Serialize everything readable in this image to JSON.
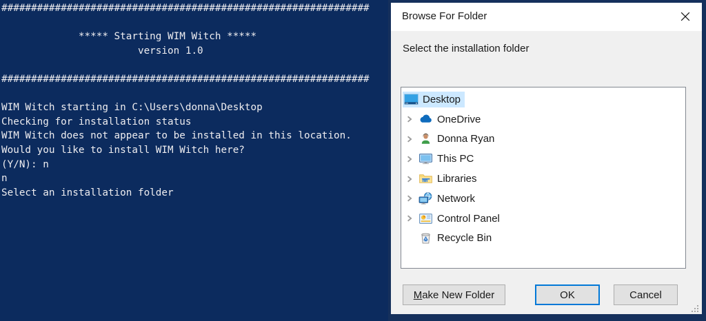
{
  "console": {
    "window_name": "powershell-console",
    "lines": [
      "##############################################################",
      "",
      "             ***** Starting WIM Witch *****",
      "                       version 1.0",
      "",
      "##############################################################",
      "",
      "WIM Witch starting in C:\\Users\\donna\\Desktop",
      "Checking for installation status",
      "WIM Witch does not appear to be installed in this location.",
      "Would you like to install WIM Witch here?",
      "(Y/N): n",
      "n",
      "Select an installation folder"
    ],
    "colors": {
      "background": "#0c2b5e",
      "foreground": "#eeedf0"
    }
  },
  "dialog": {
    "title": "Browse For Folder",
    "prompt": "Select the installation folder",
    "tree": {
      "items": [
        {
          "label": "Desktop",
          "icon": "desktop-icon",
          "expandable": false,
          "selected": true,
          "level": 0
        },
        {
          "label": "OneDrive",
          "icon": "onedrive-icon",
          "expandable": true,
          "selected": false,
          "level": 1
        },
        {
          "label": "Donna Ryan",
          "icon": "user-icon",
          "expandable": true,
          "selected": false,
          "level": 1
        },
        {
          "label": "This PC",
          "icon": "this-pc-icon",
          "expandable": true,
          "selected": false,
          "level": 1
        },
        {
          "label": "Libraries",
          "icon": "libraries-icon",
          "expandable": true,
          "selected": false,
          "level": 1
        },
        {
          "label": "Network",
          "icon": "network-icon",
          "expandable": true,
          "selected": false,
          "level": 1
        },
        {
          "label": "Control Panel",
          "icon": "control-panel-icon",
          "expandable": true,
          "selected": false,
          "level": 1
        },
        {
          "label": "Recycle Bin",
          "icon": "recycle-bin-icon",
          "expandable": false,
          "selected": false,
          "level": 1
        }
      ]
    },
    "buttons": {
      "make_new_folder": {
        "mnemonic": "M",
        "rest": "ake New Folder"
      },
      "ok": {
        "label": "OK",
        "default": true
      },
      "cancel": {
        "label": "Cancel"
      }
    },
    "colors": {
      "titlebar_bg": "#ffffff",
      "body_bg": "#f0f0f0",
      "window_border": "#15305c",
      "selection_bg": "#cce8ff",
      "focus_border": "#0078d7"
    }
  }
}
